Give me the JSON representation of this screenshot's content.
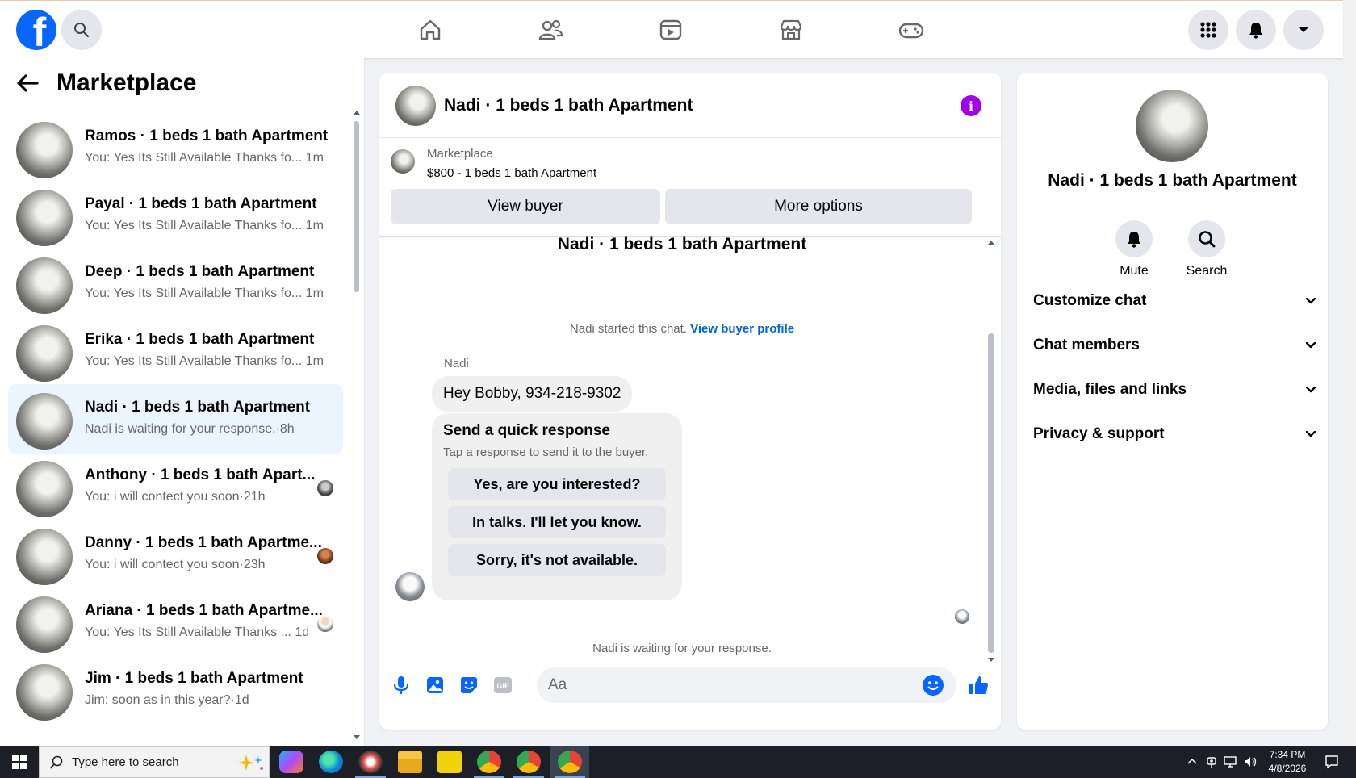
{
  "nav": {
    "search_label": "Search Facebook"
  },
  "left": {
    "title": "Marketplace",
    "conversations": [
      {
        "name": "Ramos · 1 beds 1 bath Apartment",
        "snippet": "You: Yes Its Still Available Thanks fo...",
        "time": "1m"
      },
      {
        "name": "Payal · 1 beds 1 bath Apartment",
        "snippet": "You: Yes Its Still Available Thanks fo...",
        "time": "1m"
      },
      {
        "name": "Deep · 1 beds 1 bath Apartment",
        "snippet": "You: Yes Its Still Available Thanks fo...",
        "time": "1m"
      },
      {
        "name": "Erika · 1 beds 1 bath Apartment",
        "snippet": "You: Yes Its Still Available Thanks fo...",
        "time": "1m"
      },
      {
        "name": "Nadi · 1 beds 1 bath Apartment",
        "snippet": "Nadi is waiting for your response.",
        "time": "8h"
      },
      {
        "name": "Anthony · 1 beds 1 bath Apart...",
        "snippet": "You: i will contect you soon",
        "time": "21h"
      },
      {
        "name": "Danny · 1 beds 1 bath Apartme...",
        "snippet": "You: i will contect you soon",
        "time": "23h"
      },
      {
        "name": "Ariana · 1 beds 1 bath Apartme...",
        "snippet": "You: Yes Its Still Available Thanks ...",
        "time": "1d"
      },
      {
        "name": "Jim · 1 beds 1 bath Apartment",
        "snippet": "Jim: soon as in this year?",
        "time": "1d"
      }
    ]
  },
  "chat": {
    "title": "Nadi · 1 beds 1 bath Apartment",
    "marketplace_label": "Marketplace",
    "listing": "$800 - 1 beds 1 bath Apartment",
    "view_buyer": "View buyer",
    "more_options": "More options",
    "thread_title": "Nadi · 1 beds 1 bath Apartment",
    "started_text": "Nadi started this chat.",
    "view_profile": "View buyer profile",
    "sender": "Nadi",
    "message": "Hey Bobby, 934-218-9302",
    "quick_title": "Send a quick response",
    "quick_sub": "Tap a response to send it to the buyer.",
    "quick_replies": [
      "Yes, are you interested?",
      "In talks. I'll let you know.",
      "Sorry, it's not available."
    ],
    "waiting": "Nadi is waiting for your response.",
    "composer_placeholder": "Aa"
  },
  "right": {
    "name": "Nadi · 1 beds 1 bath Apartment",
    "mute": "Mute",
    "search": "Search",
    "sections": [
      "Customize chat",
      "Chat members",
      "Media, files and links",
      "Privacy & support"
    ]
  },
  "taskbar": {
    "search_placeholder": "Type here to search",
    "time": "7:34 PM",
    "date": "4/8/2026"
  },
  "colors": {
    "brand": "#0866ff",
    "info": "#a100e8",
    "active_row": "#ebf5ff"
  }
}
